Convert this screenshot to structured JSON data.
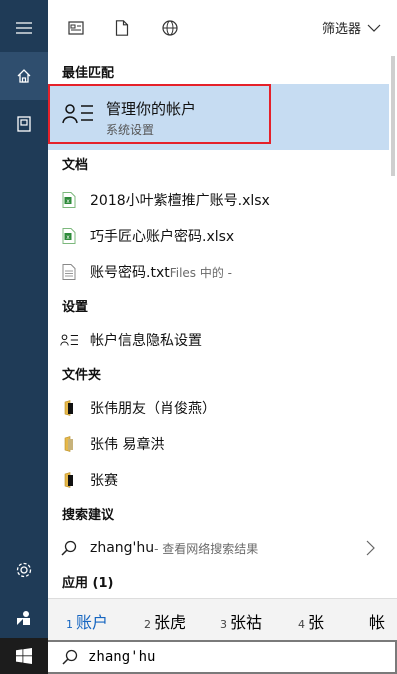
{
  "toolbar": {
    "filter_label": "筛选器"
  },
  "sections": {
    "best": "最佳匹配",
    "documents": "文档",
    "settings": "设置",
    "folders": "文件夹",
    "suggestions": "搜索建议",
    "apps": "应用 (1)"
  },
  "best_match": {
    "title": "管理你的帐户",
    "subtitle": "系统设置"
  },
  "documents": [
    {
      "name": "2018小叶紫檀推广账号.xlsx",
      "icon": "excel-file-icon"
    },
    {
      "name": "巧手匠心账户密码.xlsx",
      "icon": "excel-file-icon"
    },
    {
      "name": "账号密码.txt",
      "extra": "Files 中的 -",
      "icon": "text-file-icon"
    }
  ],
  "settings": [
    {
      "name": "帐户信息隐私设置",
      "icon": "person-list-icon"
    }
  ],
  "folders": [
    {
      "name": "张伟朋友（肖俊燕）",
      "icon": "folder-icon"
    },
    {
      "name": "张伟 易章洪",
      "icon": "folder-icon"
    },
    {
      "name": "张赛",
      "icon": "folder-icon"
    }
  ],
  "suggestion": {
    "query": "zhang'hu",
    "hint": " - 查看网络搜索结果"
  },
  "ime": {
    "candidates": [
      {
        "num": "1",
        "text": "账户"
      },
      {
        "num": "2",
        "text": "张虎"
      },
      {
        "num": "3",
        "text": "张祜"
      },
      {
        "num": "4",
        "text": "张"
      },
      {
        "num": "",
        "text": "帐"
      }
    ]
  },
  "search": {
    "value": "zhang'hu"
  },
  "colors": {
    "rail": "#1f3b57",
    "selected": "#c6dcf2",
    "highlight_border": "#e5212a",
    "ime_selected": "#1565c0"
  }
}
